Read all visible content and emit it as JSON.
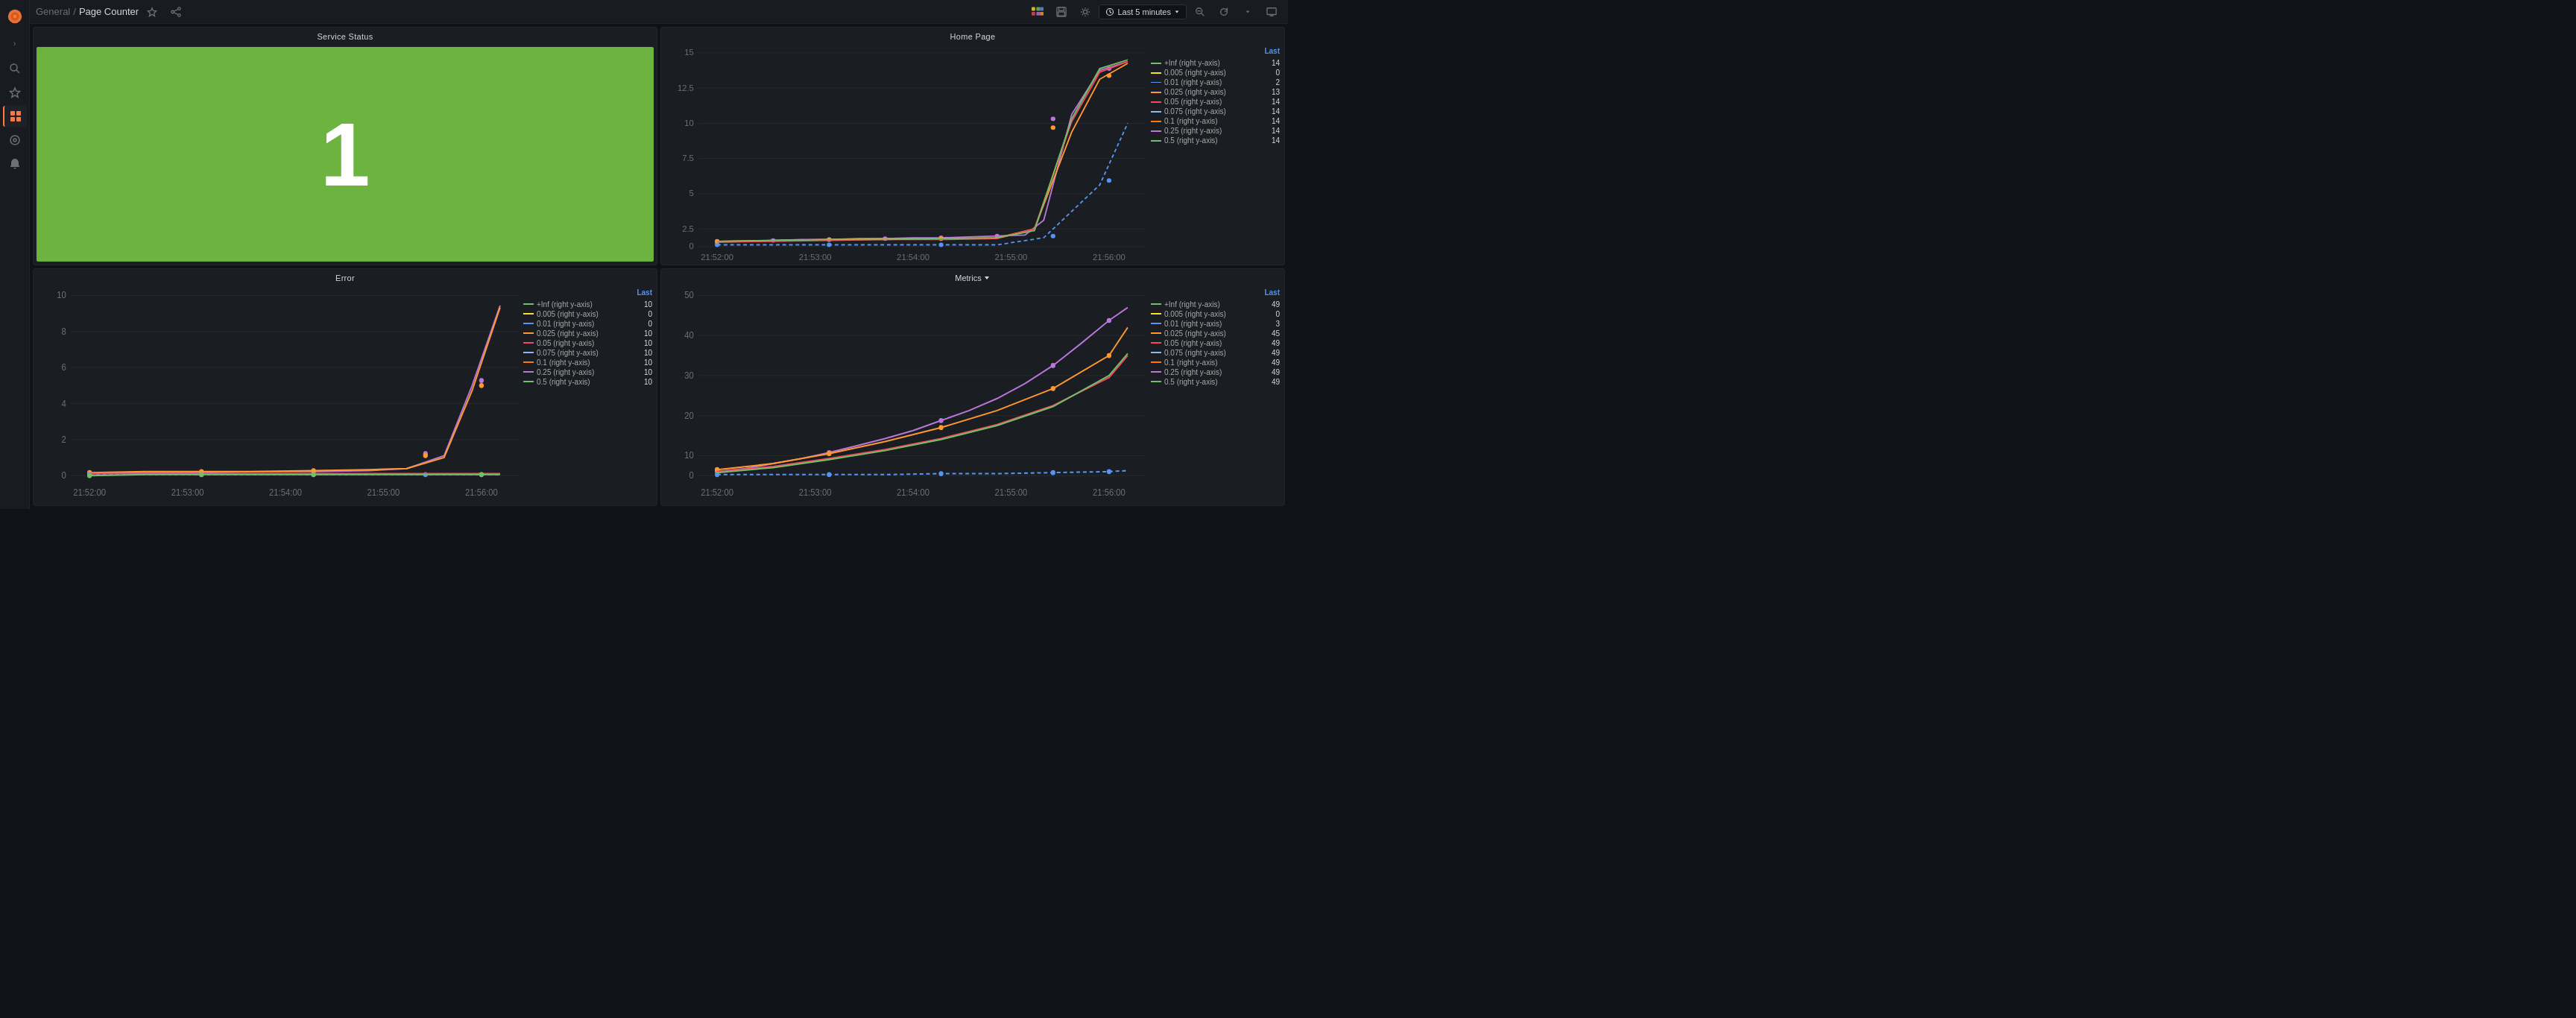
{
  "sidebar": {
    "logo_color": "#ff7941",
    "chevron_label": "›",
    "items": [
      {
        "id": "search",
        "icon": "🔍",
        "label": "Search",
        "active": false
      },
      {
        "id": "starred",
        "icon": "★",
        "label": "Starred",
        "active": false
      },
      {
        "id": "dashboards",
        "icon": "⊞",
        "label": "Dashboards",
        "active": true
      },
      {
        "id": "explore",
        "icon": "◎",
        "label": "Explore",
        "active": false
      },
      {
        "id": "alerting",
        "icon": "🔔",
        "label": "Alerting",
        "active": false
      }
    ]
  },
  "topbar": {
    "general_label": "General",
    "separator": "/",
    "page_title": "Page Counter",
    "time_range": "Last 5 minutes",
    "actions": {
      "graph_icon": "bar-chart-icon",
      "save_icon": "save-icon",
      "settings_icon": "settings-icon",
      "zoom_out_icon": "zoom-out-icon",
      "refresh_icon": "refresh-icon",
      "more_icon": "more-icon",
      "display_icon": "display-icon"
    }
  },
  "panels": {
    "service_status": {
      "title": "Service Status",
      "value": "1",
      "bg_color": "#6db33f"
    },
    "home_page": {
      "title": "Home Page",
      "x_labels": [
        "21:52:00",
        "21:53:00",
        "21:54:00",
        "21:55:00",
        "21:56:00"
      ],
      "y_labels": [
        "0",
        "2.5",
        "5",
        "7.5",
        "10",
        "12.5",
        "15"
      ],
      "legend_header_last": "Last",
      "legend_items": [
        {
          "color": "#73bf69",
          "label": "+Inf (right y-axis)",
          "value": "14",
          "dashed": false
        },
        {
          "color": "#fade2a",
          "label": "0.005 (right y-axis)",
          "value": "0",
          "dashed": false
        },
        {
          "color": "#5794f2",
          "label": "0.01 (right y-axis)",
          "value": "2",
          "dashed": true
        },
        {
          "color": "#ff9830",
          "label": "0.025 (right y-axis)",
          "value": "13",
          "dashed": false
        },
        {
          "color": "#f2495c",
          "label": "0.05 (right y-axis)",
          "value": "14",
          "dashed": false
        },
        {
          "color": "#8ab8ff",
          "label": "0.075 (right y-axis)",
          "value": "14",
          "dashed": true
        },
        {
          "color": "#ff780a",
          "label": "0.1 (right y-axis)",
          "value": "14",
          "dashed": false
        },
        {
          "color": "#b877d9",
          "label": "0.25 (right y-axis)",
          "value": "14",
          "dashed": false
        },
        {
          "color": "#73bf69",
          "label": "0.5 (right y-axis)",
          "value": "14",
          "dashed": true
        }
      ]
    },
    "error": {
      "title": "Error",
      "x_labels": [
        "21:52:00",
        "21:53:00",
        "21:54:00",
        "21:55:00",
        "21:56:00"
      ],
      "y_labels": [
        "0",
        "2",
        "4",
        "6",
        "8",
        "10"
      ],
      "legend_header_last": "Last",
      "legend_items": [
        {
          "color": "#73bf69",
          "label": "+Inf (right y-axis)",
          "value": "10",
          "dashed": false
        },
        {
          "color": "#fade2a",
          "label": "0.005 (right y-axis)",
          "value": "0",
          "dashed": false
        },
        {
          "color": "#5794f2",
          "label": "0.01 (right y-axis)",
          "value": "0",
          "dashed": true
        },
        {
          "color": "#ff9830",
          "label": "0.025 (right y-axis)",
          "value": "10",
          "dashed": false
        },
        {
          "color": "#f2495c",
          "label": "0.05 (right y-axis)",
          "value": "10",
          "dashed": false
        },
        {
          "color": "#8ab8ff",
          "label": "0.075 (right y-axis)",
          "value": "10",
          "dashed": true
        },
        {
          "color": "#ff780a",
          "label": "0.1 (right y-axis)",
          "value": "10",
          "dashed": false
        },
        {
          "color": "#b877d9",
          "label": "0.25 (right y-axis)",
          "value": "10",
          "dashed": false
        },
        {
          "color": "#73bf69",
          "label": "0.5 (right y-axis)",
          "value": "10",
          "dashed": true
        }
      ]
    },
    "metrics": {
      "title": "Metrics",
      "has_dropdown": true,
      "x_labels": [
        "21:52:00",
        "21:53:00",
        "21:54:00",
        "21:55:00",
        "21:56:00"
      ],
      "y_labels": [
        "0",
        "10",
        "20",
        "30",
        "40",
        "50"
      ],
      "legend_header_last": "Last",
      "legend_items": [
        {
          "color": "#73bf69",
          "label": "+Inf (right y-axis)",
          "value": "49",
          "dashed": false
        },
        {
          "color": "#fade2a",
          "label": "0.005 (right y-axis)",
          "value": "0",
          "dashed": false
        },
        {
          "color": "#5794f2",
          "label": "0.01 (right y-axis)",
          "value": "3",
          "dashed": true
        },
        {
          "color": "#ff9830",
          "label": "0.025 (right y-axis)",
          "value": "45",
          "dashed": false
        },
        {
          "color": "#f2495c",
          "label": "0.05 (right y-axis)",
          "value": "49",
          "dashed": false
        },
        {
          "color": "#8ab8ff",
          "label": "0.075 (right y-axis)",
          "value": "49",
          "dashed": true
        },
        {
          "color": "#ff780a",
          "label": "0.1 (right y-axis)",
          "value": "49",
          "dashed": false
        },
        {
          "color": "#b877d9",
          "label": "0.25 (right y-axis)",
          "value": "49",
          "dashed": false
        },
        {
          "color": "#73bf69",
          "label": "0.5 (right y-axis)",
          "value": "49",
          "dashed": true
        }
      ]
    }
  }
}
